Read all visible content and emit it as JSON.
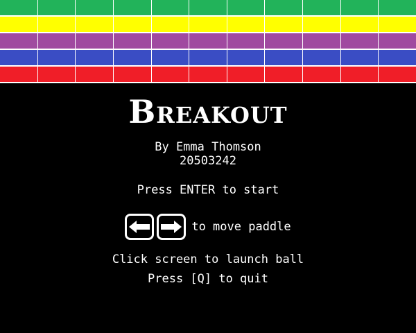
{
  "title": "Breakout",
  "author_line": "By Emma Thomson",
  "student_id": "20503242",
  "start_prompt": "Press ENTER to start",
  "move_hint": "to move paddle",
  "launch_hint": "Click screen to launch ball",
  "quit_hint": "Press [Q] to quit",
  "keys": [
    "left-arrow-icon",
    "right-arrow-icon"
  ],
  "brick_rows": [
    {
      "color": "#22b35a",
      "count": 11
    },
    {
      "color": "#ffff00",
      "count": 11
    },
    {
      "color": "#a04aa0",
      "count": 11
    },
    {
      "color": "#3a4dc4",
      "count": 11
    },
    {
      "color": "#f01e28",
      "count": 11
    }
  ]
}
